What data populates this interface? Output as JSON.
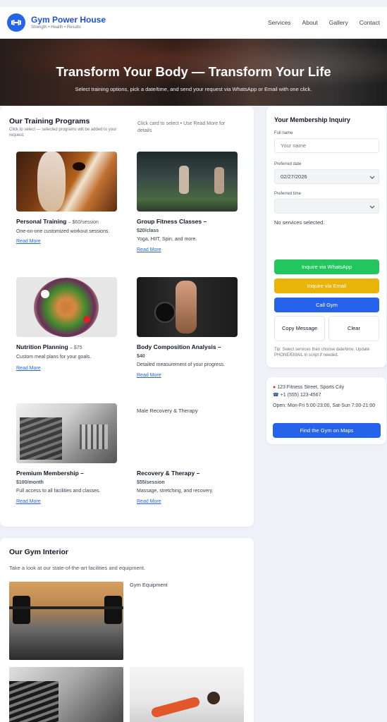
{
  "header": {
    "brand_name": "Gym Power House",
    "tagline": "Strength • Health • Results",
    "nav": [
      "Services",
      "About",
      "Gallery",
      "Contact"
    ]
  },
  "hero": {
    "title": "Transform Your Body — Transform Your Life",
    "subtitle": "Select training options, pick a date/time, and send your request via WhatsApp or Email with one click."
  },
  "programs": {
    "title": "Our Training Programs",
    "hint_left": "Click to select — selected programs will be added to your request.",
    "hint_right": "Click card to select • Use Read More for details",
    "read_more": "Read More",
    "items": [
      {
        "title": "Personal Training",
        "price": "– $60/session",
        "desc": "One-on-one customized workout sessions."
      },
      {
        "title": "Group Fitness Classes –",
        "price": "$20/class",
        "desc": "Yoga, HIIT, Spin, and more."
      },
      {
        "title": "Nutrition Planning",
        "price": "– $75",
        "desc": "Custom meal plans for your goals."
      },
      {
        "title": "Body Composition Analysis –",
        "price": "$40",
        "desc": "Detailed measurement of your progress."
      },
      {
        "title": "Premium Membership –",
        "price": "$100/month",
        "desc": "Full access to all facilities and classes."
      },
      {
        "title": "Recovery & Therapy –",
        "price": "$55/session",
        "desc": "Massage, stretching, and recovery.",
        "alt": "Male Recovery & Therapy"
      }
    ]
  },
  "interior": {
    "title": "Our Gym Interior",
    "subtitle": "Take a look at our state-of-the-art facilities and equipment.",
    "broken_alt": "Gym Equipment"
  },
  "inquiry": {
    "title": "Your Membership Inquiry",
    "full_name_label": "Full name",
    "full_name_placeholder": "Your name",
    "date_label": "Preferred date",
    "date_value": "02/27/2026",
    "time_label": "Preferred time",
    "time_value": "",
    "selected_services": "No services selected.",
    "whatsapp_btn": "Inquire via WhatsApp",
    "email_btn": "Inquire via Email",
    "call_btn": "Call Gym",
    "copy_btn": "Copy Message",
    "clear_btn": "Clear",
    "tip": "Tip: Select services then choose date/time. Update PHONE/EMAIL in script if needed.",
    "colors": {
      "whatsapp": "#22c55e",
      "email": "#eab308",
      "call": "#2563eb"
    }
  },
  "contact": {
    "address": "123 Fitness Street, Sports City",
    "phone": "+1 (555) 123-4567",
    "hours": "Open: Mon-Fri 5:00-23:00, Sat-Sun 7:00-21:00",
    "maps_btn": "Find the Gym on Maps"
  }
}
